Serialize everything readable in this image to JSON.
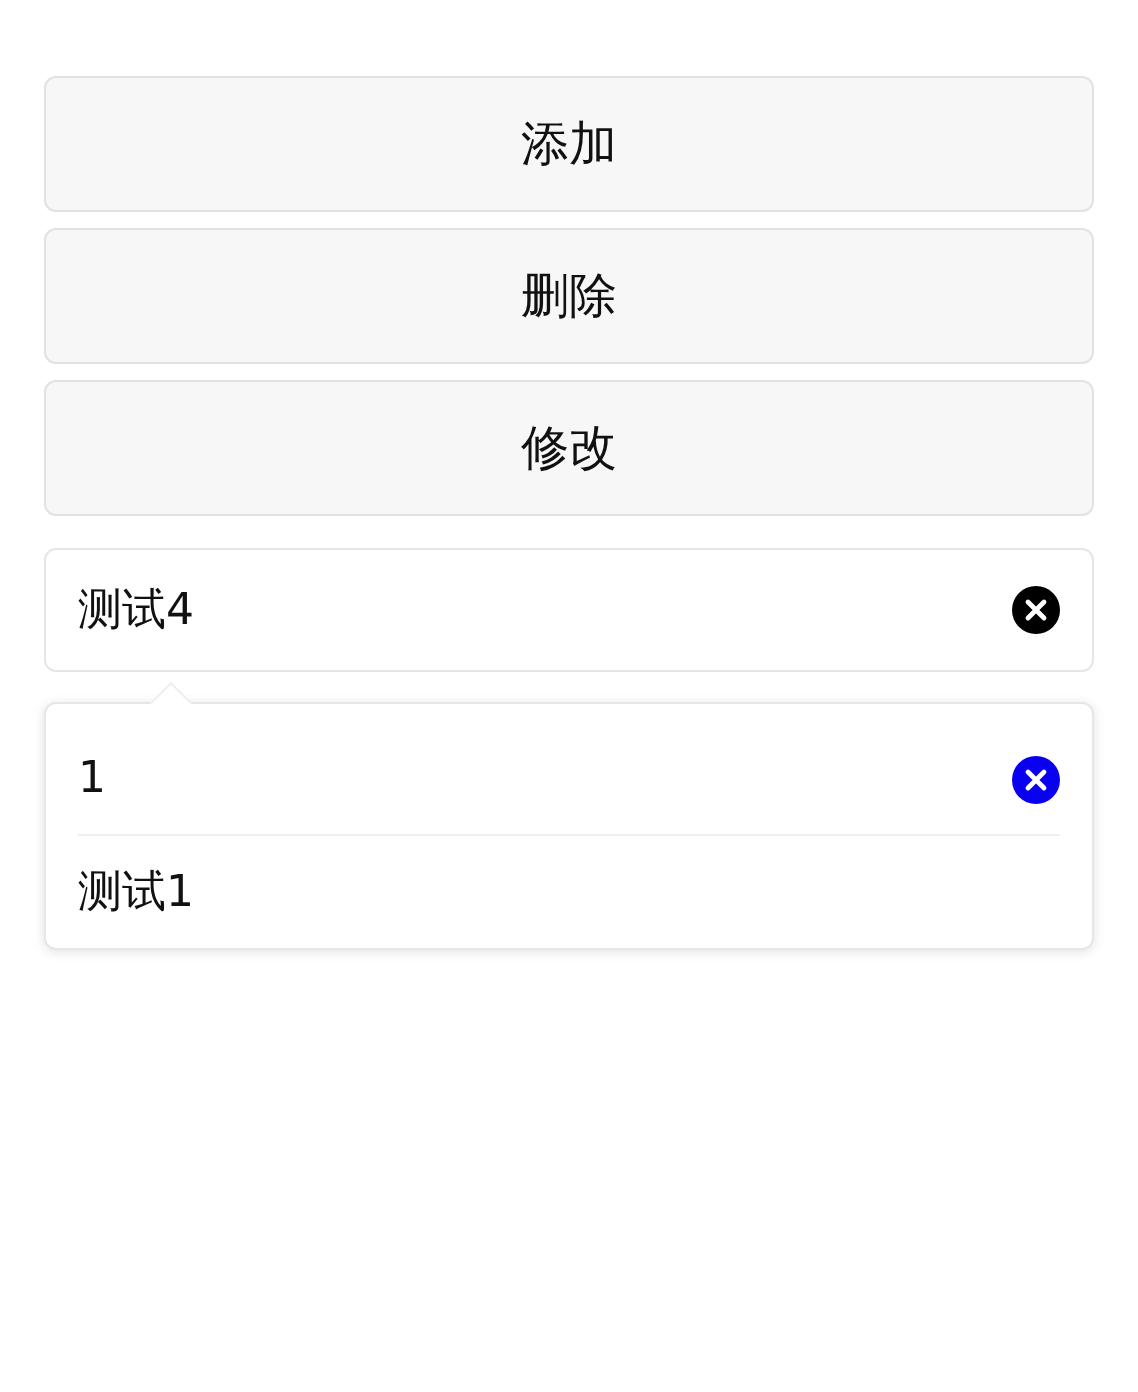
{
  "buttons": [
    {
      "label": "添加"
    },
    {
      "label": "删除"
    },
    {
      "label": "修改"
    }
  ],
  "input": {
    "value": "测试4"
  },
  "suggestions": [
    {
      "label": "1",
      "selected": true
    },
    {
      "label": "测试1",
      "selected": false
    }
  ]
}
